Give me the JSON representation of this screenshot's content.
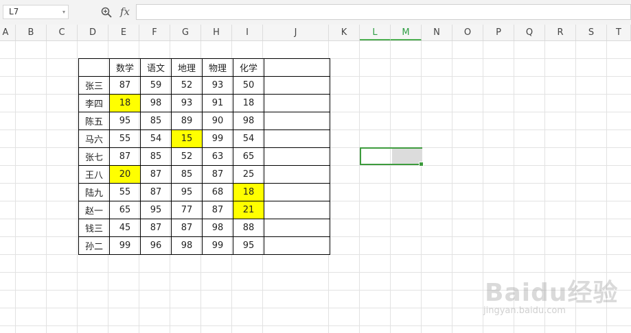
{
  "formula_bar": {
    "name_box": "L7",
    "fx_label": "fx",
    "formula_value": ""
  },
  "columns": [
    {
      "label": "A"
    },
    {
      "label": "B"
    },
    {
      "label": "C"
    },
    {
      "label": "D"
    },
    {
      "label": "E"
    },
    {
      "label": "F"
    },
    {
      "label": "G"
    },
    {
      "label": "H"
    },
    {
      "label": "I"
    },
    {
      "label": "J"
    },
    {
      "label": "K"
    },
    {
      "label": "L",
      "selected": true
    },
    {
      "label": "M",
      "selected": true
    },
    {
      "label": "N"
    },
    {
      "label": "O"
    },
    {
      "label": "P"
    },
    {
      "label": "Q"
    },
    {
      "label": "R"
    },
    {
      "label": "S"
    },
    {
      "label": "T"
    }
  ],
  "table": {
    "header": [
      "",
      "数学",
      "语文",
      "地理",
      "物理",
      "化学",
      ""
    ],
    "rows": [
      {
        "cells": [
          "张三",
          "87",
          "59",
          "52",
          "93",
          "50",
          ""
        ],
        "highlight": []
      },
      {
        "cells": [
          "李四",
          "18",
          "98",
          "93",
          "91",
          "18",
          ""
        ],
        "highlight": [
          1
        ]
      },
      {
        "cells": [
          "陈五",
          "95",
          "85",
          "89",
          "90",
          "98",
          ""
        ],
        "highlight": []
      },
      {
        "cells": [
          "马六",
          "55",
          "54",
          "15",
          "99",
          "54",
          ""
        ],
        "highlight": [
          3
        ]
      },
      {
        "cells": [
          "张七",
          "87",
          "85",
          "52",
          "63",
          "65",
          ""
        ],
        "highlight": []
      },
      {
        "cells": [
          "王八",
          "20",
          "87",
          "85",
          "87",
          "25",
          ""
        ],
        "highlight": [
          1
        ]
      },
      {
        "cells": [
          "陆九",
          "55",
          "87",
          "95",
          "68",
          "18",
          ""
        ],
        "highlight": [
          5
        ]
      },
      {
        "cells": [
          "赵一",
          "65",
          "95",
          "77",
          "87",
          "21",
          ""
        ],
        "highlight": [
          5
        ]
      },
      {
        "cells": [
          "钱三",
          "45",
          "87",
          "87",
          "98",
          "88",
          ""
        ],
        "highlight": []
      },
      {
        "cells": [
          "孙二",
          "99",
          "96",
          "98",
          "99",
          "95",
          ""
        ],
        "highlight": []
      }
    ]
  },
  "colors": {
    "highlight": "#ffff00",
    "selection": "#3d9b3d"
  },
  "watermark": {
    "main": "Baidu经验",
    "sub": "jingyan.baidu.com"
  }
}
